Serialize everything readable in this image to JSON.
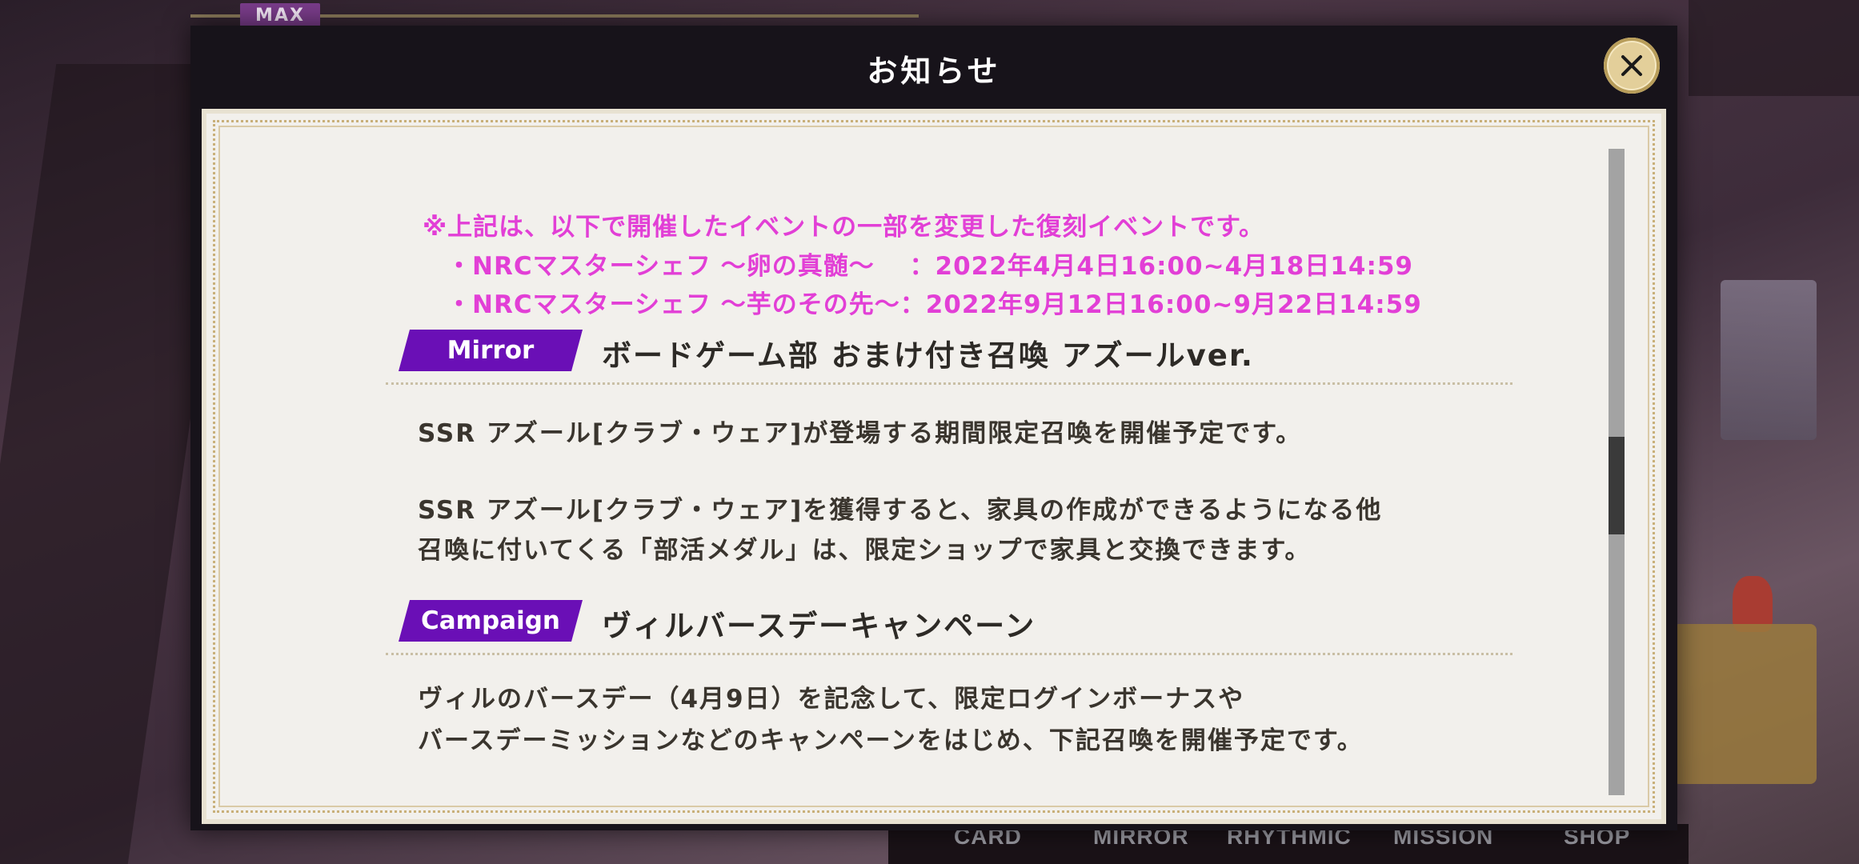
{
  "background": {
    "badge": "MAX",
    "nav_items": [
      "CARD",
      "MIRROR",
      "RHYTHMIC",
      "MISSION",
      "SHOP"
    ]
  },
  "modal": {
    "title": "お知らせ",
    "close_icon": "close-icon"
  },
  "notice": {
    "note_lines": [
      "※上記は、以下で開催したイベントの一部を変更した復刻イベントです。",
      "・NRCマスターシェフ ～卵の真髄～　 ：2022年4月4日16:00~4月18日14:59",
      "・NRCマスターシェフ ～芋のその先～：2022年9月12日16:00~9月22日14:59"
    ],
    "sections": [
      {
        "tag": "Mirror",
        "title": "ボードゲーム部 おまけ付き召喚 アズールver.",
        "body": [
          "SSR アズール[クラブ・ウェア]が登場する期間限定召喚を開催予定です。",
          "SSR アズール[クラブ・ウェア]を獲得すると、家具の作成ができるようになる他",
          "召喚に付いてくる「部活メダル」は、限定ショップで家具と交換できます。"
        ]
      },
      {
        "tag": "Campaign",
        "title": "ヴィルバースデーキャンペーン",
        "body": [
          "ヴィルのバースデー（4月9日）を記念して、限定ログインボーナスや",
          "バースデーミッションなどのキャンペーンをはじめ、下記召喚を開催予定です。"
        ]
      }
    ]
  },
  "colors": {
    "note": "#e23fd6",
    "tag_bg": "#6a0fb6",
    "close_button": "#e3cf9a"
  }
}
